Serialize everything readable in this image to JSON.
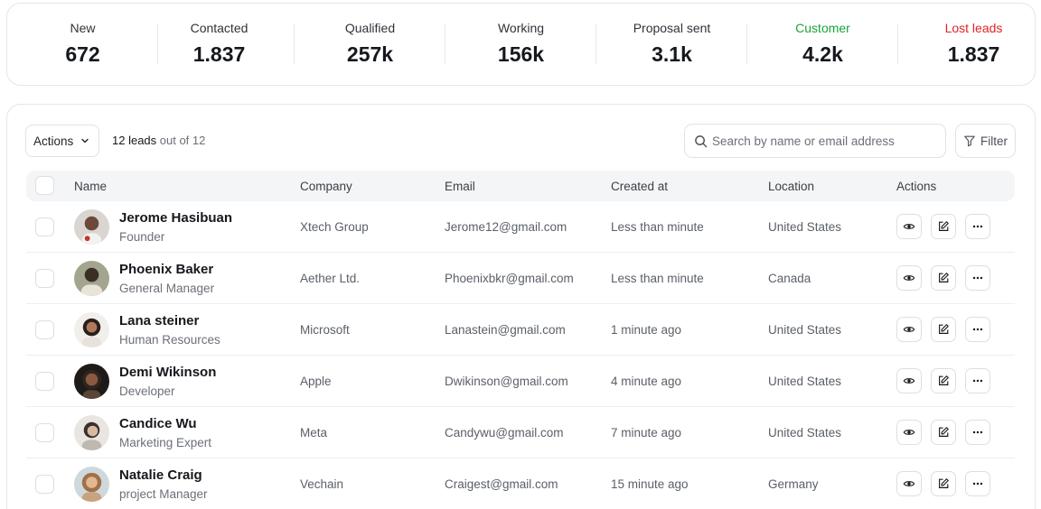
{
  "stats": [
    {
      "label": "New",
      "value": "672",
      "color": "#2f3338"
    },
    {
      "label": "Contacted",
      "value": "1.837",
      "color": "#2f3338"
    },
    {
      "label": "Qualified",
      "value": "257k",
      "color": "#2f3338"
    },
    {
      "label": "Working",
      "value": "156k",
      "color": "#2f3338"
    },
    {
      "label": "Proposal sent",
      "value": "3.1k",
      "color": "#2f3338"
    },
    {
      "label": "Customer",
      "value": "4.2k",
      "color": "#1aa33a"
    },
    {
      "label": "Lost leads",
      "value": "1.837",
      "color": "#e02424"
    }
  ],
  "toolbar": {
    "actions_label": "Actions",
    "count_strong": "12 leads",
    "count_muted": " out of 12",
    "search_placeholder": "Search by name or email address",
    "filter_label": "Filter"
  },
  "table": {
    "headers": {
      "name": "Name",
      "company": "Company",
      "email": "Email",
      "created": "Created at",
      "location": "Location",
      "actions": "Actions"
    },
    "rows": [
      {
        "name": "Jerome Hasibuan",
        "role": "Founder",
        "company": "Xtech Group",
        "email": "Jerome12@gmail.com",
        "created": "Less than minute",
        "location": "United States"
      },
      {
        "name": "Phoenix Baker",
        "role": "General Manager",
        "company": "Aether Ltd.",
        "email": "Phoenixbkr@gmail.com",
        "created": "Less than minute",
        "location": "Canada"
      },
      {
        "name": "Lana steiner",
        "role": "Human Resources",
        "company": "Microsoft",
        "email": "Lanastein@gmail.com",
        "created": "1 minute ago",
        "location": "United States"
      },
      {
        "name": "Demi Wikinson",
        "role": "Developer",
        "company": "Apple",
        "email": "Dwikinson@gmail.com",
        "created": "4 minute ago",
        "location": "United States"
      },
      {
        "name": "Candice Wu",
        "role": "Marketing Expert",
        "company": "Meta",
        "email": "Candywu@gmail.com",
        "created": "7 minute ago",
        "location": "United States"
      },
      {
        "name": "Natalie Craig",
        "role": "project Manager",
        "company": "Vechain",
        "email": "Craigest@gmail.com",
        "created": "15 minute ago",
        "location": "Germany"
      }
    ]
  },
  "icons": {
    "view": "eye-icon",
    "edit": "edit-icon",
    "more": "more-horizontal-icon",
    "search": "search-icon",
    "filter": "filter-icon"
  }
}
